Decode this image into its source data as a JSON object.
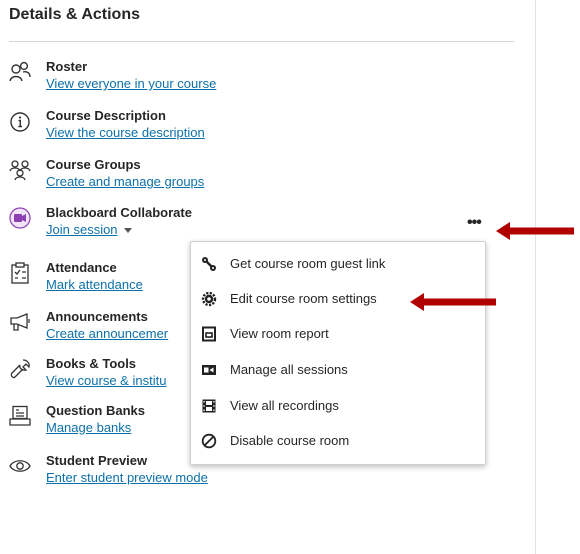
{
  "panel": {
    "title": "Details & Actions"
  },
  "items": [
    {
      "name": "Roster",
      "link": "View everyone in your course",
      "icon": "people-icon"
    },
    {
      "name": "Course Description",
      "link": "View the course description",
      "icon": "info-icon"
    },
    {
      "name": "Course Groups",
      "link": "Create and manage groups",
      "icon": "groups-icon"
    },
    {
      "name": "Blackboard Collaborate",
      "link": "Join session",
      "icon": "collaborate-icon"
    },
    {
      "name": "Attendance",
      "link": "Mark attendance",
      "icon": "clipboard-icon"
    },
    {
      "name": "Announcements",
      "link": "Create announcemer",
      "icon": "megaphone-icon"
    },
    {
      "name": "Books & Tools",
      "link": "View course & institu",
      "icon": "wrench-icon"
    },
    {
      "name": "Question Banks",
      "link": "Manage banks",
      "icon": "question-bank-icon"
    },
    {
      "name": "Student Preview",
      "link": "Enter student preview mode",
      "icon": "eye-icon"
    }
  ],
  "more_button": {
    "label": "•••"
  },
  "menu": {
    "items": [
      {
        "label": "Get course room guest link",
        "icon": "link-icon"
      },
      {
        "label": "Edit course room settings",
        "icon": "settings-icon"
      },
      {
        "label": "View room report",
        "icon": "report-icon"
      },
      {
        "label": "Manage all sessions",
        "icon": "sessions-icon"
      },
      {
        "label": "View all recordings",
        "icon": "film-icon"
      },
      {
        "label": "Disable course room",
        "icon": "disable-icon"
      }
    ]
  },
  "colors": {
    "link": "#0d70a8",
    "annotation_arrow": "#b00000",
    "collaborate_purple": "#8b3fb2"
  }
}
